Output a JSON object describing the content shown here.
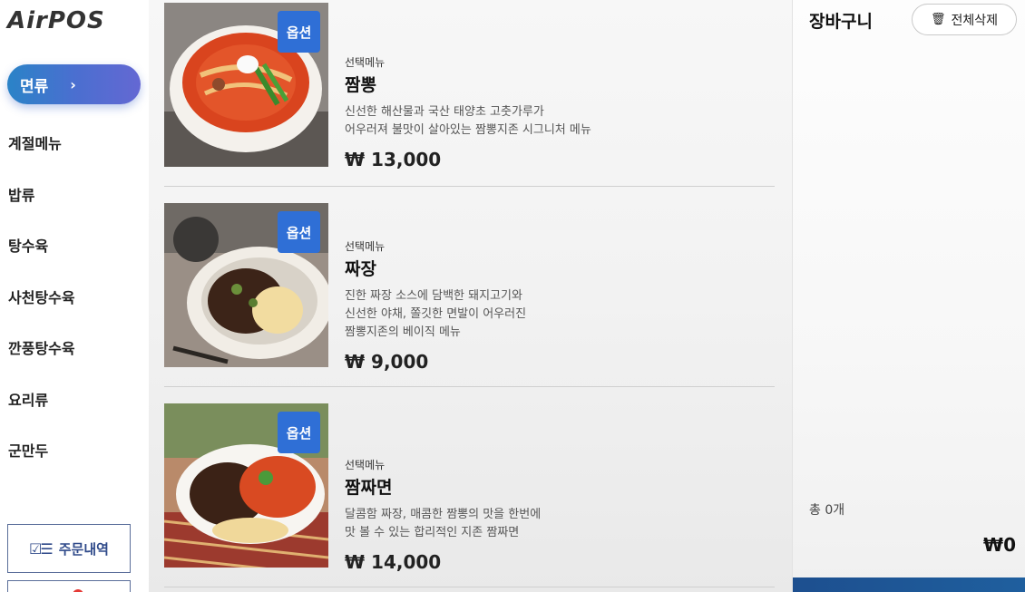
{
  "brand": {
    "logo_text": "AirPOS"
  },
  "sidebar": {
    "active_category": "면류",
    "chevron": "›",
    "categories": [
      "계절메뉴",
      "밥류",
      "탕수육",
      "사천탕수육",
      "깐풍탕수육",
      "요리류",
      "군만두"
    ],
    "order_history_label": "주문내역",
    "order_history_icon": "checklist-icon"
  },
  "menu": {
    "items": [
      {
        "tag": "선택메뉴",
        "name": "짬뽕",
        "description": "신선한 해산물과 국산 태양초 고춧가루가\n어우러져 불맛이 살아있는 짬뽕지존 시그니처 메뉴",
        "price": "₩ 13,000",
        "badge": "옵션",
        "image": "jjamppong-photo"
      },
      {
        "tag": "선택메뉴",
        "name": "짜장",
        "description": "진한 짜장 소스에 담백한 돼지고기와\n신선한 야채, 쫄깃한 면발이 어우러진\n짬뽕지존의 베이직 메뉴",
        "price": "₩ 9,000",
        "badge": "옵션",
        "image": "jjajang-photo"
      },
      {
        "tag": "선택메뉴",
        "name": "짬짜면",
        "description": "달콤함 짜장, 매콤한 짬뽕의 맛을 한번에\n맛 볼 수 있는 합리적인 지존 짬짜면",
        "price": "₩ 14,000",
        "badge": "옵션",
        "image": "jjamjjamyeon-photo"
      }
    ]
  },
  "cart": {
    "title": "장바구니",
    "clear_all_label": "전체삭제",
    "clear_icon": "trash-icon",
    "total_count": "총 0개",
    "total_price": "₩0"
  },
  "colors": {
    "accent_blue": "#2f6fd6",
    "active_gradient_start": "#2a83c7",
    "active_gradient_end": "#6468d3",
    "pay_bar": "#1d4f8f"
  }
}
